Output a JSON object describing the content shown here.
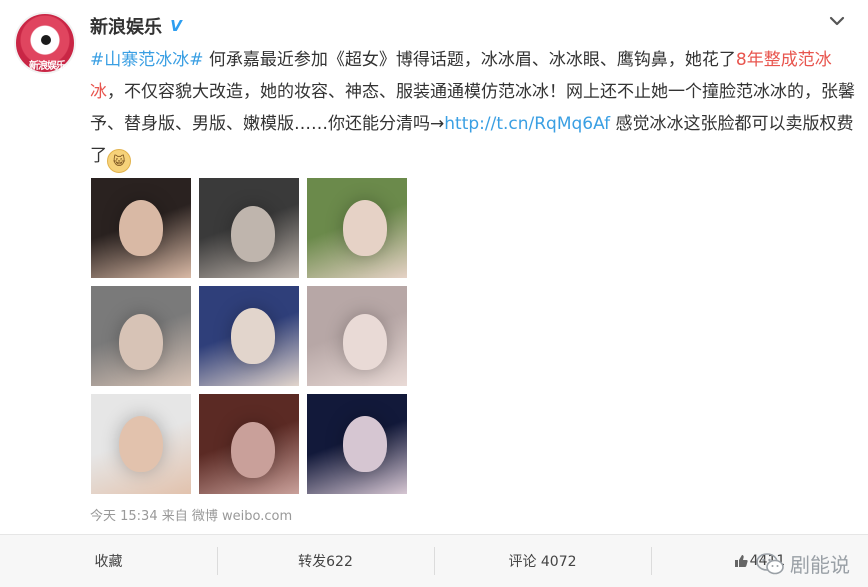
{
  "post": {
    "author": "新浪娱乐",
    "avatar_text": "新浪娱乐",
    "verified": true,
    "text_parts": {
      "hashtag": "#山寨范冰冰#",
      "t1": "何承嘉最近参加《超女》博得话题，冰冰眉、冰冰眼、鹰钩鼻，她花了",
      "highlight": "8年整成范冰冰",
      "t2": "，不仅容貌大改造，她的妆容、神态、服装通通模仿范冰冰！网上还不止她一个撞脸范冰冰的，张馨予、替身版、男版、嫩模版……你还能分清吗→",
      "link": "http://t.cn/RqMq6Af",
      "t3": "感觉冰冰这张脸都可以卖版权费了"
    },
    "emoji": "cat-face-emoji",
    "timestamp": "今天 15:34",
    "source_prefix": "来自",
    "source": "微博 weibo.com"
  },
  "actions": {
    "favorite": "收藏",
    "repost": "转发622",
    "comment": "评论 4072",
    "like": "4411"
  },
  "watermark": "剧能说",
  "colors": {
    "link": "#3a9fe3",
    "highlight": "#e8554e",
    "verified": "#2d9ef0"
  },
  "images": [
    {
      "name": "photo-1",
      "palette": [
        "#2a2220",
        "#d9b9a5"
      ]
    },
    {
      "name": "photo-2",
      "palette": [
        "#3a3a3a",
        "#bfb5ad"
      ]
    },
    {
      "name": "photo-3",
      "palette": [
        "#6b8a4b",
        "#e6d2c6"
      ]
    },
    {
      "name": "photo-4",
      "palette": [
        "#7a7a7a",
        "#d7c3b6"
      ]
    },
    {
      "name": "photo-5",
      "palette": [
        "#2f3f7a",
        "#e2d5cc"
      ]
    },
    {
      "name": "photo-6",
      "palette": [
        "#b7a7a6",
        "#e9dad6"
      ]
    },
    {
      "name": "photo-7",
      "palette": [
        "#e6e6e6",
        "#e2c2ad"
      ]
    },
    {
      "name": "photo-8",
      "palette": [
        "#5b2a24",
        "#c9a09a"
      ]
    },
    {
      "name": "photo-9",
      "palette": [
        "#12193a",
        "#d6c6d2"
      ]
    }
  ]
}
